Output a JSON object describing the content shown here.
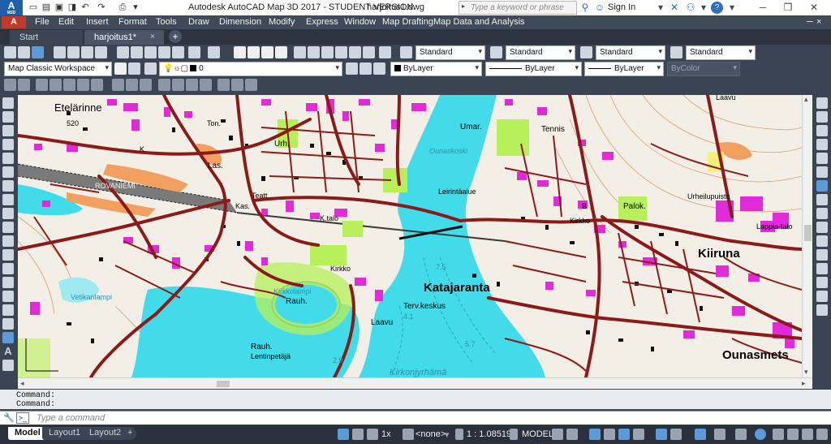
{
  "titlebar": {
    "logo_letter": "A",
    "logo_sub": "M3D",
    "app_title": "Autodesk AutoCAD Map 3D 2017 - STUDENT VERSION",
    "doc_title": "harjoitus1.dwg",
    "search_placeholder": "Type a keyword or phrase",
    "signin_label": "Sign In",
    "help_label": "?"
  },
  "menubar": {
    "items": [
      "File",
      "Edit",
      "Insert",
      "Format",
      "Tools",
      "Draw",
      "Dimension",
      "Modify",
      "Express",
      "Window",
      "Map Drafting",
      "Map Data and Analysis"
    ]
  },
  "tabs": {
    "start": "Start",
    "active": "harjoitus1*",
    "close": "×",
    "plus": "+"
  },
  "toolbar1": {
    "text_style": "Standard",
    "dim_style": "Standard",
    "table_style": "Standard",
    "mleader_style": "Standard"
  },
  "toolbar2": {
    "workspace": "Map Classic Workspace",
    "layer": "0",
    "color": "ByLayer",
    "linetype": "ByLayer",
    "lineweight": "ByLayer",
    "plotstyle": "ByColor"
  },
  "map": {
    "labels": {
      "etelarinne": "Etelärinne",
      "elev520": "520",
      "ton": "Ton.",
      "k1": "K",
      "urh1": "Urh.",
      "las": "Las.",
      "teatt": "Teatt",
      "kas": "Kas.",
      "rovaniemi": "ROVANIEMI",
      "pirtti": "Pirttilampi",
      "umar": "Umar.",
      "tennis": "Tennis",
      "ounaskoski": "Ounaskoski",
      "leiri": "Leirintäalue",
      "ktalo": "K.talo",
      "kirkko1": "Kirkko",
      "katajaranta": "Katajaranta",
      "terv": "Terv.keskus",
      "laavu": "Laavu",
      "kirkkolampi": "Kirkkolampi",
      "rauh1": "Rauh.",
      "rauh2": "Rauh.",
      "lentin": "Lentinpetäjä",
      "vetik": "Vetikanlampi",
      "kirkonjyrhama": "Kirkonjyrhämä",
      "kirkko2": "Kirkko",
      "b": "B",
      "palok": "Palok.",
      "urheilu": "Urheilupuisto",
      "lappi": "Lappia-talo",
      "kiiruna": "Kiiruna",
      "ounasmets": "Ounasmets",
      "laavu_top": "Laavu",
      "d75": "7.5",
      "d57": "5.7",
      "d41": "4.1",
      "d29": "2.9"
    }
  },
  "command": {
    "history": [
      "Command:",
      "Command:"
    ],
    "placeholder": "Type a command"
  },
  "statusbar": {
    "model_tab": "Model",
    "layout1": "Layout1",
    "layout2": "Layout2",
    "plus": "+",
    "anno_scale": "1x",
    "coord_none": "<none>",
    "scale": "1 : 1.08519",
    "model_label": "MODEL"
  },
  "colors": {
    "road": "#8b1a1a",
    "water": "#41dbe9",
    "building": "#e12bd8",
    "park": "#b7f05a",
    "sand": "#f2a060"
  }
}
